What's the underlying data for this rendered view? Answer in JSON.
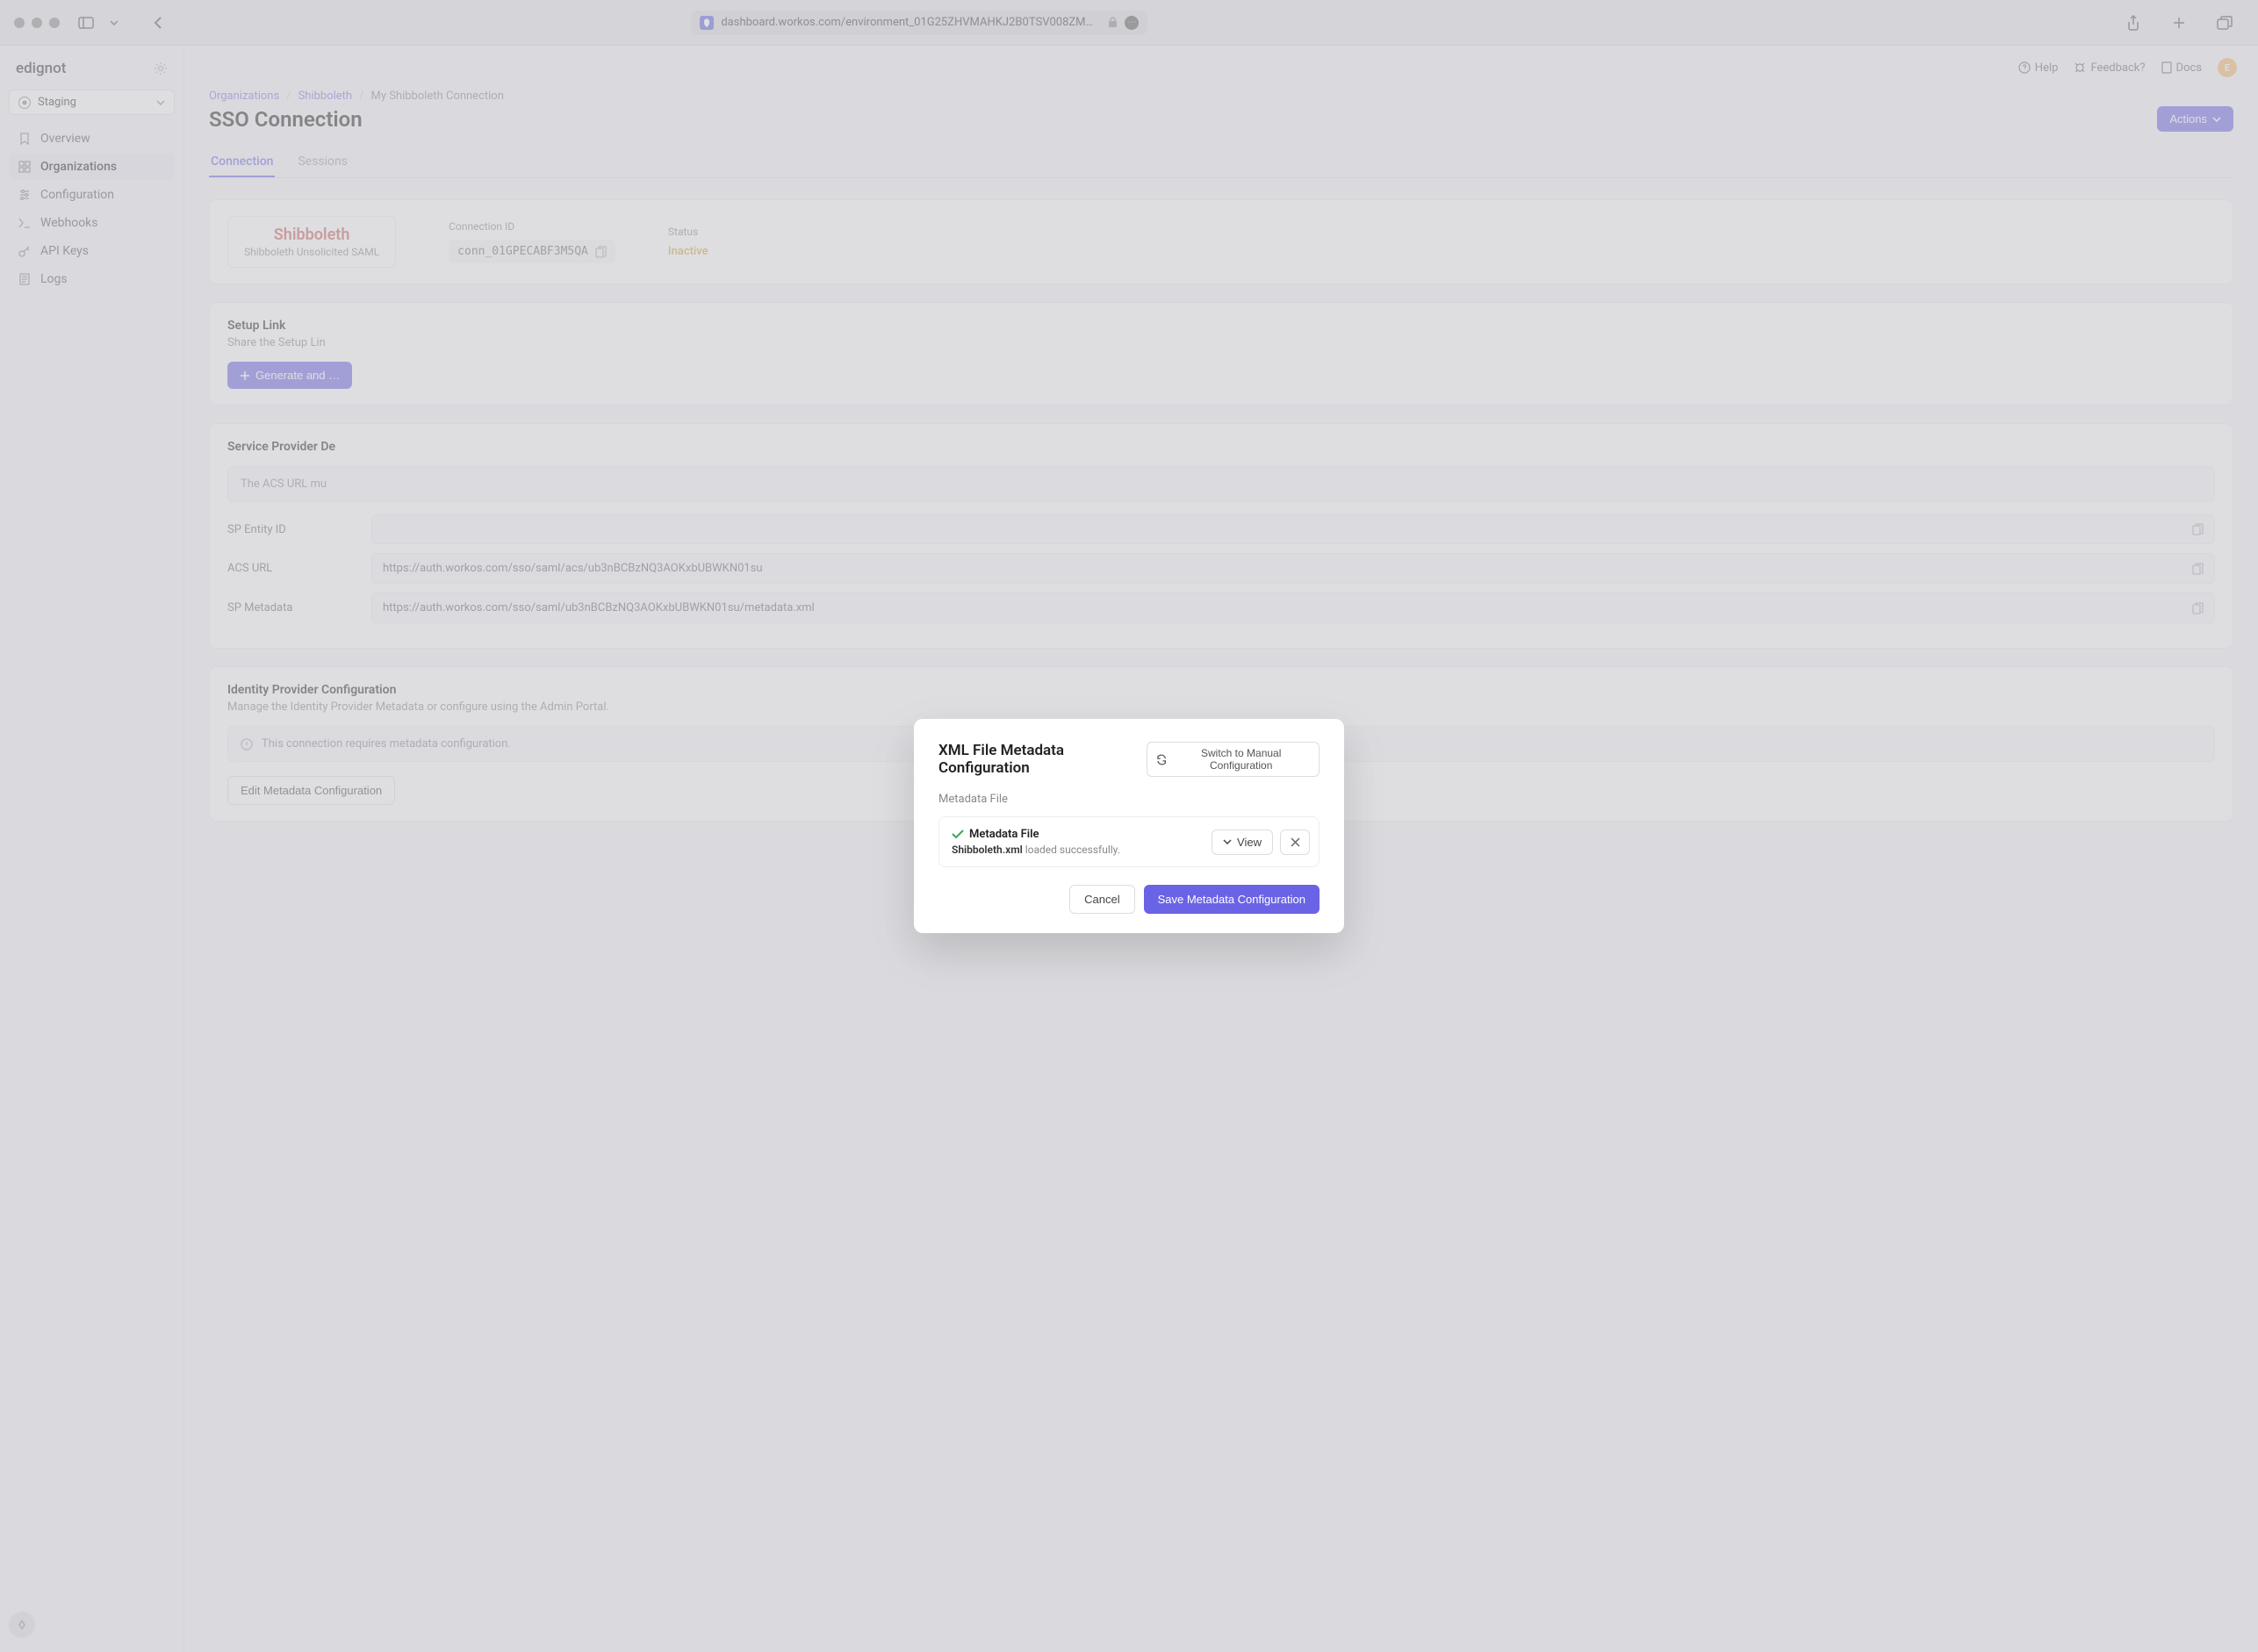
{
  "browser": {
    "url": "dashboard.workos.com/environment_01G25ZHVMAHKJ2B0TSV008ZM…"
  },
  "workspace": {
    "name": "edignot"
  },
  "env_selector": {
    "label": "Staging"
  },
  "sidebar": {
    "items": [
      {
        "label": "Overview"
      },
      {
        "label": "Organizations"
      },
      {
        "label": "Configuration"
      },
      {
        "label": "Webhooks"
      },
      {
        "label": "API Keys"
      },
      {
        "label": "Logs"
      }
    ]
  },
  "topbar": {
    "help": "Help",
    "feedback": "Feedback?",
    "docs": "Docs",
    "avatar_letter": "E"
  },
  "breadcrumb": {
    "org": "Organizations",
    "app": "Shibboleth",
    "current": "My Shibboleth Connection"
  },
  "page": {
    "title": "SSO Connection",
    "actions_label": "Actions"
  },
  "tabs": [
    {
      "label": "Connection"
    },
    {
      "label": "Sessions"
    }
  ],
  "connection_card": {
    "provider": "Shibboleth",
    "provider_sub": "Shibboleth Unsolicited SAML",
    "id_label": "Connection ID",
    "id_value": "conn_01GPECABF3M5QA",
    "status_label": "Status",
    "status_value": "Inactive"
  },
  "setup": {
    "title": "Setup Link",
    "subtitle": "Share the Setup Lin",
    "button": "Generate and …"
  },
  "sp_details": {
    "title": "Service Provider De",
    "banner": "The ACS URL mu",
    "rows": [
      {
        "label": "SP Entity ID",
        "value": ""
      },
      {
        "label": "ACS URL",
        "value": "https://auth.workos.com/sso/saml/acs/ub3nBCBzNQ3AOKxbUBWKN01su"
      },
      {
        "label": "SP Metadata",
        "value": "https://auth.workos.com/sso/saml/ub3nBCBzNQ3AOKxbUBWKN01su/metadata.xml"
      }
    ]
  },
  "idp_config": {
    "title": "Identity Provider Configuration",
    "subtitle": "Manage the Identity Provider Metadata or configure using the Admin Portal.",
    "warning": "This connection requires metadata configuration.",
    "edit_button": "Edit Metadata Configuration"
  },
  "modal": {
    "title": "XML File Metadata Configuration",
    "switch": "Switch to Manual Configuration",
    "field_label": "Metadata File",
    "file_title": "Metadata File",
    "file_name": "Shibboleth.xml",
    "file_status": "loaded successfully.",
    "view": "View",
    "cancel": "Cancel",
    "save": "Save Metadata Configuration"
  }
}
